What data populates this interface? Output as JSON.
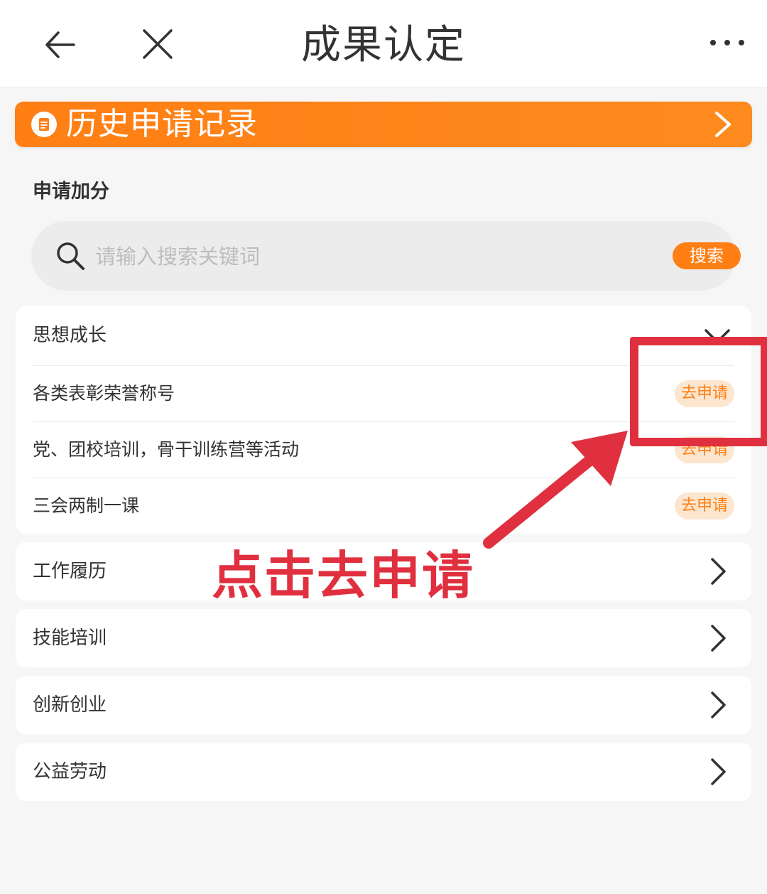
{
  "nav": {
    "title": "成果认定"
  },
  "history": {
    "label": "历史申请记录"
  },
  "section": {
    "title": "申请加分"
  },
  "search": {
    "placeholder": "请输入搜索关键词",
    "button_label": "搜索"
  },
  "categories": [
    {
      "title": "思想成长",
      "expanded": true,
      "items": [
        {
          "label": "各类表彰荣誉称号",
          "action": "去申请"
        },
        {
          "label": "党、团校培训，骨干训练营等活动",
          "action": "去申请"
        },
        {
          "label": "三会两制一课",
          "action": "去申请"
        }
      ]
    },
    {
      "title": "工作履历",
      "expanded": false
    },
    {
      "title": "技能培训",
      "expanded": false
    },
    {
      "title": "创新创业",
      "expanded": false
    },
    {
      "title": "公益劳动",
      "expanded": false
    }
  ],
  "annotation": {
    "text": "点击去申请"
  },
  "colors": {
    "accent": "#ff7f14",
    "apply_bg": "#fde6cf",
    "annotation": "#e0303f",
    "page_bg": "#f6f6f6"
  }
}
